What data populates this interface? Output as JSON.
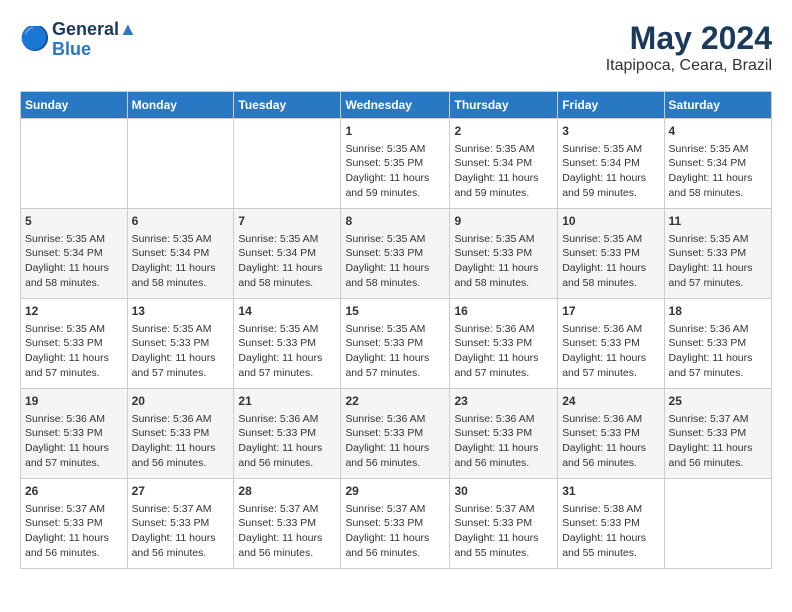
{
  "header": {
    "logo_line1": "General",
    "logo_line2": "Blue",
    "title": "May 2024",
    "subtitle": "Itapipoca, Ceara, Brazil"
  },
  "calendar": {
    "days_of_week": [
      "Sunday",
      "Monday",
      "Tuesday",
      "Wednesday",
      "Thursday",
      "Friday",
      "Saturday"
    ],
    "weeks": [
      [
        {
          "day": "",
          "content": ""
        },
        {
          "day": "",
          "content": ""
        },
        {
          "day": "",
          "content": ""
        },
        {
          "day": "1",
          "content": "Sunrise: 5:35 AM\nSunset: 5:35 PM\nDaylight: 11 hours and 59 minutes."
        },
        {
          "day": "2",
          "content": "Sunrise: 5:35 AM\nSunset: 5:34 PM\nDaylight: 11 hours and 59 minutes."
        },
        {
          "day": "3",
          "content": "Sunrise: 5:35 AM\nSunset: 5:34 PM\nDaylight: 11 hours and 59 minutes."
        },
        {
          "day": "4",
          "content": "Sunrise: 5:35 AM\nSunset: 5:34 PM\nDaylight: 11 hours and 58 minutes."
        }
      ],
      [
        {
          "day": "5",
          "content": "Sunrise: 5:35 AM\nSunset: 5:34 PM\nDaylight: 11 hours and 58 minutes."
        },
        {
          "day": "6",
          "content": "Sunrise: 5:35 AM\nSunset: 5:34 PM\nDaylight: 11 hours and 58 minutes."
        },
        {
          "day": "7",
          "content": "Sunrise: 5:35 AM\nSunset: 5:34 PM\nDaylight: 11 hours and 58 minutes."
        },
        {
          "day": "8",
          "content": "Sunrise: 5:35 AM\nSunset: 5:33 PM\nDaylight: 11 hours and 58 minutes."
        },
        {
          "day": "9",
          "content": "Sunrise: 5:35 AM\nSunset: 5:33 PM\nDaylight: 11 hours and 58 minutes."
        },
        {
          "day": "10",
          "content": "Sunrise: 5:35 AM\nSunset: 5:33 PM\nDaylight: 11 hours and 58 minutes."
        },
        {
          "day": "11",
          "content": "Sunrise: 5:35 AM\nSunset: 5:33 PM\nDaylight: 11 hours and 57 minutes."
        }
      ],
      [
        {
          "day": "12",
          "content": "Sunrise: 5:35 AM\nSunset: 5:33 PM\nDaylight: 11 hours and 57 minutes."
        },
        {
          "day": "13",
          "content": "Sunrise: 5:35 AM\nSunset: 5:33 PM\nDaylight: 11 hours and 57 minutes."
        },
        {
          "day": "14",
          "content": "Sunrise: 5:35 AM\nSunset: 5:33 PM\nDaylight: 11 hours and 57 minutes."
        },
        {
          "day": "15",
          "content": "Sunrise: 5:35 AM\nSunset: 5:33 PM\nDaylight: 11 hours and 57 minutes."
        },
        {
          "day": "16",
          "content": "Sunrise: 5:36 AM\nSunset: 5:33 PM\nDaylight: 11 hours and 57 minutes."
        },
        {
          "day": "17",
          "content": "Sunrise: 5:36 AM\nSunset: 5:33 PM\nDaylight: 11 hours and 57 minutes."
        },
        {
          "day": "18",
          "content": "Sunrise: 5:36 AM\nSunset: 5:33 PM\nDaylight: 11 hours and 57 minutes."
        }
      ],
      [
        {
          "day": "19",
          "content": "Sunrise: 5:36 AM\nSunset: 5:33 PM\nDaylight: 11 hours and 57 minutes."
        },
        {
          "day": "20",
          "content": "Sunrise: 5:36 AM\nSunset: 5:33 PM\nDaylight: 11 hours and 56 minutes."
        },
        {
          "day": "21",
          "content": "Sunrise: 5:36 AM\nSunset: 5:33 PM\nDaylight: 11 hours and 56 minutes."
        },
        {
          "day": "22",
          "content": "Sunrise: 5:36 AM\nSunset: 5:33 PM\nDaylight: 11 hours and 56 minutes."
        },
        {
          "day": "23",
          "content": "Sunrise: 5:36 AM\nSunset: 5:33 PM\nDaylight: 11 hours and 56 minutes."
        },
        {
          "day": "24",
          "content": "Sunrise: 5:36 AM\nSunset: 5:33 PM\nDaylight: 11 hours and 56 minutes."
        },
        {
          "day": "25",
          "content": "Sunrise: 5:37 AM\nSunset: 5:33 PM\nDaylight: 11 hours and 56 minutes."
        }
      ],
      [
        {
          "day": "26",
          "content": "Sunrise: 5:37 AM\nSunset: 5:33 PM\nDaylight: 11 hours and 56 minutes."
        },
        {
          "day": "27",
          "content": "Sunrise: 5:37 AM\nSunset: 5:33 PM\nDaylight: 11 hours and 56 minutes."
        },
        {
          "day": "28",
          "content": "Sunrise: 5:37 AM\nSunset: 5:33 PM\nDaylight: 11 hours and 56 minutes."
        },
        {
          "day": "29",
          "content": "Sunrise: 5:37 AM\nSunset: 5:33 PM\nDaylight: 11 hours and 56 minutes."
        },
        {
          "day": "30",
          "content": "Sunrise: 5:37 AM\nSunset: 5:33 PM\nDaylight: 11 hours and 55 minutes."
        },
        {
          "day": "31",
          "content": "Sunrise: 5:38 AM\nSunset: 5:33 PM\nDaylight: 11 hours and 55 minutes."
        },
        {
          "day": "",
          "content": ""
        }
      ]
    ]
  }
}
